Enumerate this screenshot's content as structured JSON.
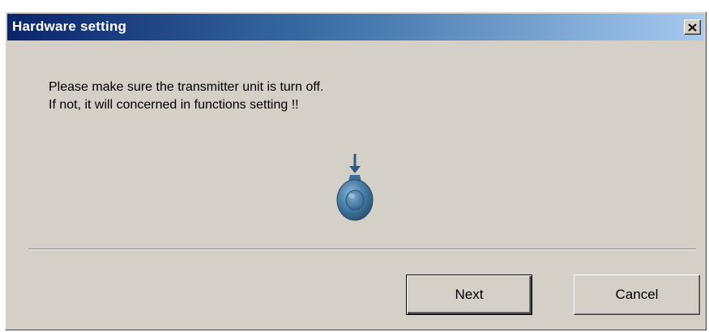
{
  "window": {
    "title": "Hardware setting",
    "close_icon": "close-icon"
  },
  "message": {
    "line1": "Please make sure the transmitter unit is turn off.",
    "line2": "If not, it will concerned in functions setting !!"
  },
  "graphic": {
    "icon": "power-knob-icon",
    "color": "#4a7ea6"
  },
  "buttons": {
    "next_label": "Next",
    "cancel_label": "Cancel"
  },
  "colors": {
    "dialog_bg": "#d4d0c8",
    "title_start": "#0a246a",
    "title_end": "#a6caf0"
  }
}
